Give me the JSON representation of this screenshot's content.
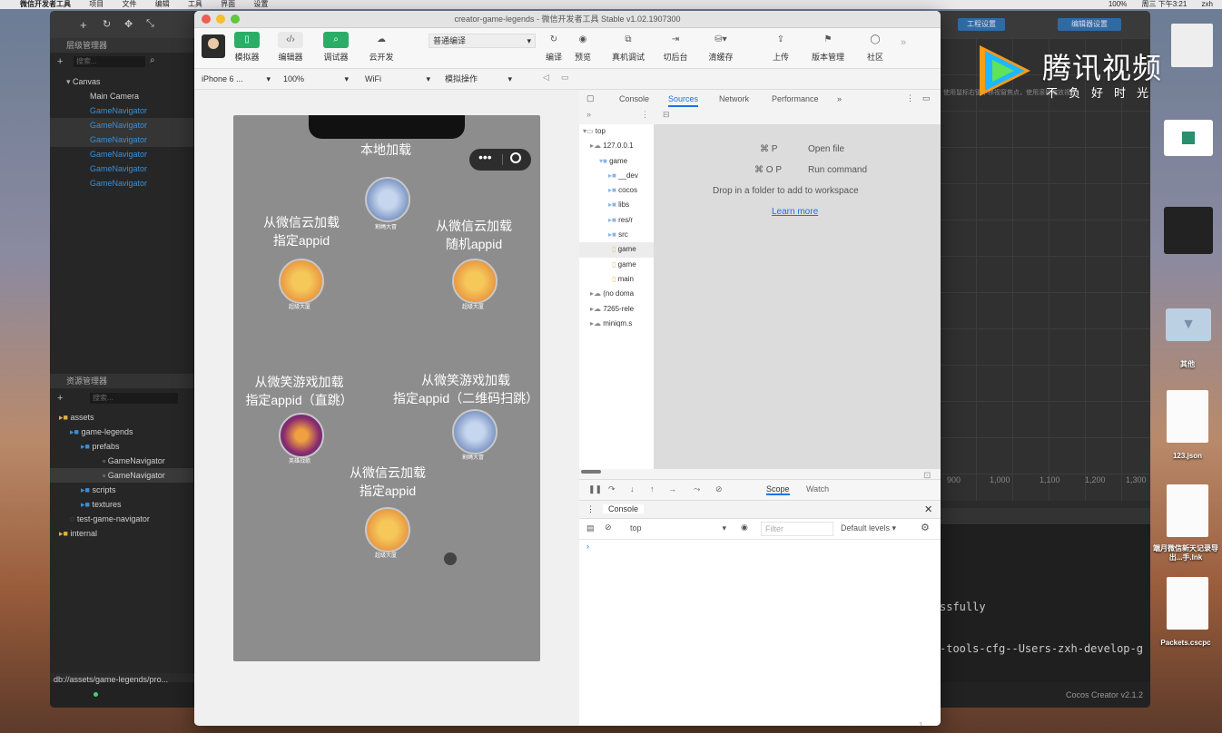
{
  "menubar": {
    "items": [
      "微信开发者工具",
      "项目",
      "文件",
      "编辑",
      "工具",
      "界面",
      "设置"
    ],
    "status": [
      "100%",
      "周三 下午3:21",
      "zxh"
    ]
  },
  "cocos": {
    "search_placeholder": "搜索...",
    "hierarchy": [
      {
        "label": "Canvas",
        "color": "#cfcfcf"
      },
      {
        "label": "Main Camera",
        "color": "#cfcfcf"
      },
      {
        "label": "GameNavigator",
        "color": "#3b8fd6"
      },
      {
        "label": "GameNavigator",
        "color": "#3b8fd6"
      },
      {
        "label": "GameNavigator",
        "color": "#3b8fd6"
      },
      {
        "label": "GameNavigator",
        "color": "#3b8fd6"
      },
      {
        "label": "GameNavigator",
        "color": "#3b8fd6"
      },
      {
        "label": "GameNavigator",
        "color": "#3b8fd6"
      }
    ],
    "assets_title": "资源管理器",
    "hierarchy_title": "层级管理器",
    "assets": [
      "assets",
      "game-legends",
      "prefabs",
      "GameNavigator",
      "GameNavigator",
      "scripts",
      "textures",
      "test-game-navigator",
      "internal"
    ],
    "status_path": "db://assets/game-legends/pro...",
    "version": "Cocos Creator v2.1.2",
    "scene_ruler": [
      "900",
      "1,000",
      "1,100",
      "1,200",
      "1,300"
    ],
    "scene_tabs": [
      "工程设置",
      "编辑器设置"
    ],
    "scene_hint": "使用鼠标右键平移视窗焦点，使用滚轮缩放视图",
    "console_lines": [
      "ssfully",
      "-tools-cfg--Users-zxh-develop-g"
    ]
  },
  "devtool": {
    "title": "creator-game-legends - 微信开发者工具 Stable v1.02.1907300",
    "toolbar": [
      "模拟器",
      "编辑器",
      "调试器",
      "云开发",
      "编译",
      "预览",
      "真机调试",
      "切后台",
      "清缓存",
      "上传",
      "版本管理",
      "社区"
    ],
    "compile_mode": "普通编译",
    "device": "iPhone 6 ...",
    "zoom": "100%",
    "network": "WiFi",
    "mock": "模拟操作",
    "phone": {
      "title": "本地加载",
      "label_cloud_appid": "从微信云加载\n指定appid",
      "label_cloud_random": "从微信云加载\n随机appid",
      "label_wx_direct": "从微笑游戏加载\n指定appid（直跳）",
      "label_wx_qr": "从微笑游戏加载\n指定appid（二维码扫跳）",
      "label_cloud_appid2": "从微信云加载\n指定appid",
      "icon_name_1": "割绳大冒",
      "icon_name_2": "超级大厦",
      "icon_name_3": "超级大厦",
      "icon_name_4": "英雄战歌",
      "icon_name_5": "割绳大冒",
      "icon_name_6": "超级大厦"
    },
    "devtools": {
      "tabs": [
        "Console",
        "Sources",
        "Network",
        "Performance",
        "»"
      ],
      "files": [
        "top",
        "127.0.0.1",
        "game",
        "__dev",
        "cocos",
        "libs",
        "res/r",
        "src",
        "game",
        "game",
        "main",
        "(no doma",
        "7265-rele",
        "miniqm.s"
      ],
      "shortcuts": [
        {
          "key": "⌘ P",
          "action": "Open file"
        },
        {
          "key": "⌘ O P",
          "action": "Run command"
        }
      ],
      "drop_hint": "Drop in a folder to add to workspace",
      "learn_more": "Learn more",
      "scope_tabs": [
        "Scope",
        "Watch"
      ],
      "console_tab": "Console",
      "context": "top",
      "filter_placeholder": "Filter",
      "levels": "Default levels ▾",
      "prompt": "›",
      "count": "1"
    }
  },
  "desktop": {
    "files": [
      "123.json",
      "端月微信新天记录导出...手.lnk",
      "Packets.cscpc",
      "其他"
    ]
  },
  "watermark": {
    "brand": "腾讯视频",
    "slogan": "不负好时光"
  }
}
